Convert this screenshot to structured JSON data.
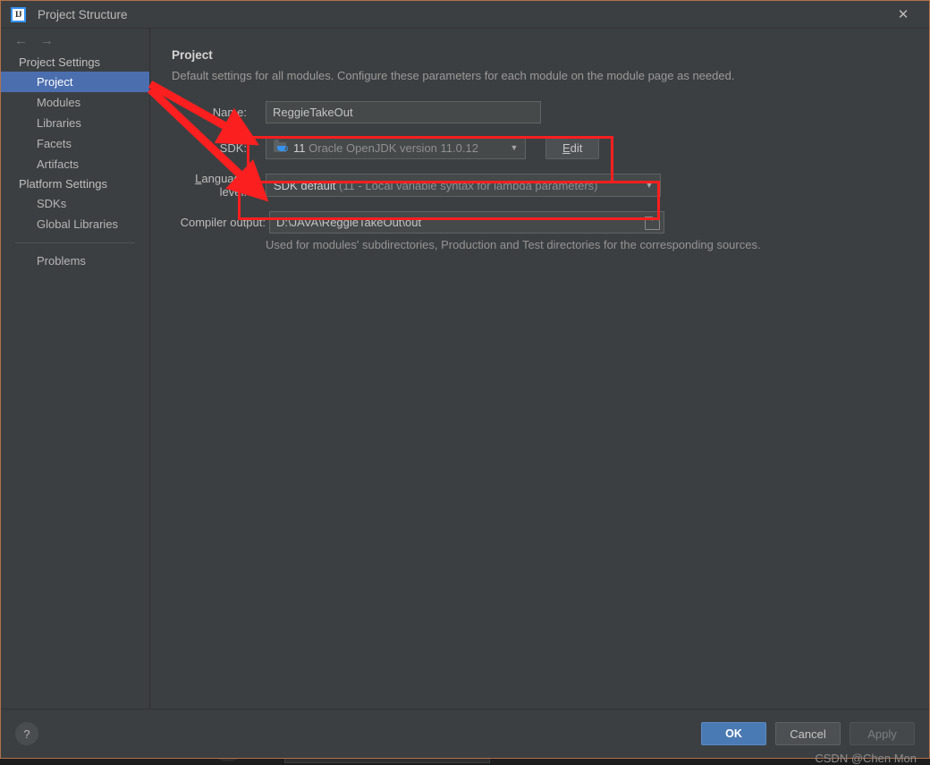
{
  "window": {
    "title": "Project Structure",
    "app_icon": "IJ",
    "close_icon": "✕"
  },
  "nav": {
    "back_icon": "←",
    "forward_icon": "→"
  },
  "sidebar": {
    "groups": [
      {
        "label": "Project Settings",
        "items": [
          {
            "label": "Project",
            "selected": true
          },
          {
            "label": "Modules",
            "selected": false
          },
          {
            "label": "Libraries",
            "selected": false
          },
          {
            "label": "Facets",
            "selected": false
          },
          {
            "label": "Artifacts",
            "selected": false
          }
        ]
      },
      {
        "label": "Platform Settings",
        "items": [
          {
            "label": "SDKs",
            "selected": false
          },
          {
            "label": "Global Libraries",
            "selected": false
          }
        ]
      }
    ],
    "problems": "Problems"
  },
  "main": {
    "title": "Project",
    "description": "Default settings for all modules. Configure these parameters for each module on the module page as needed.",
    "name": {
      "label": "Name:",
      "value": "ReggieTakeOut"
    },
    "sdk": {
      "label": "SDK:",
      "version": "11",
      "description": "Oracle OpenJDK version 11.0.12",
      "icon": "jdk-folder-icon",
      "dropdown_icon": "▼",
      "edit_label": "Edit",
      "edit_mnemonic": "E"
    },
    "language_level": {
      "label": "Language level:",
      "label_mnemonic": "L",
      "value": "SDK default",
      "detail": "(11 - Local variable syntax for lambda parameters)",
      "dropdown_icon": "▼"
    },
    "compiler_output": {
      "label": "Compiler output:",
      "value": "D:\\JAVA\\ReggieTakeOut\\out",
      "browse_icon": "folder-icon",
      "hint": "Used for modules' subdirectories, Production and Test directories for the corresponding sources."
    }
  },
  "footer": {
    "help_label": "?",
    "ok_label": "OK",
    "cancel_label": "Cancel",
    "apply_label": "Apply"
  },
  "watermark": "CSDN @Chen Mon",
  "colors": {
    "dialog_bg": "#3c3f41",
    "selection_blue": "#4b6eaf",
    "ok_blue": "#4a7ab3",
    "annotation_red": "#fb1f1f",
    "border_orange": "#b1724c"
  }
}
